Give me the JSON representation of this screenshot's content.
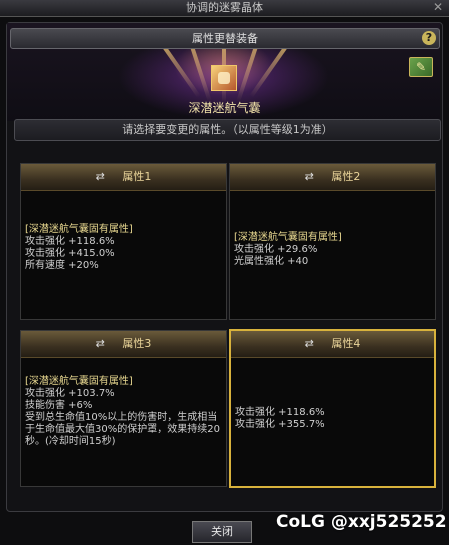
{
  "window": {
    "title": "协调的迷雾晶体"
  },
  "header": {
    "title": "属性更替装备",
    "item_name": "深潜迷航气囊",
    "instruction": "请选择要变更的属性。（以属性等级1为准）"
  },
  "cards": [
    {
      "title": "属性1",
      "lines": [
        "[深潜迷航气囊固有属性]",
        "攻击强化 +118.6%",
        "攻击强化 +415.0%",
        "所有速度 +20%"
      ]
    },
    {
      "title": "属性2",
      "lines": [
        "[深潜迷航气囊固有属性]",
        "攻击强化 +29.6%",
        "光属性强化 +40"
      ]
    },
    {
      "title": "属性3",
      "lines": [
        "[深潜迷航气囊固有属性]",
        "攻击强化 +103.7%",
        "技能伤害 +6%",
        "受到总生命值10%以上的伤害时，生成相当于生命值最大值30%的保护罩，效果持续20秒。(冷却时间15秒)"
      ]
    },
    {
      "title": "属性4",
      "lines": [
        "攻击强化 +118.6%",
        "攻击强化 +355.7%"
      ]
    }
  ],
  "footer": {
    "close_label": "关闭"
  },
  "watermark": "CoLG @xxj525252",
  "icons": {
    "help": "help-icon",
    "book": "book-icon",
    "shuffle": "shuffle-icon",
    "item": "airbag-item-icon"
  },
  "colors": {
    "selected_border": "#d8b23c",
    "gold_text": "#ead59a"
  }
}
